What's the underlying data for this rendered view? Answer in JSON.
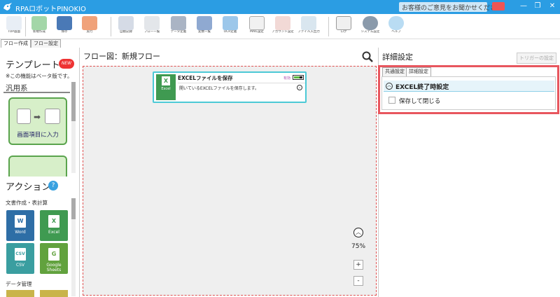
{
  "app": {
    "title": "RPAロボットPINOKIO",
    "feedback_label": "お客様のご意見をお聞かせください"
  },
  "toolbar": {
    "buttons": [
      {
        "label": "TOP画面",
        "icon": "top-screen-icon"
      },
      {
        "label": "新規作成",
        "icon": "new-file-icon"
      },
      {
        "label": "保存",
        "icon": "save-icon"
      },
      {
        "label": "実行",
        "icon": "run-icon"
      },
      {
        "label": "自動記録",
        "icon": "auto-record-icon"
      },
      {
        "label": "フロー一覧",
        "icon": "flow-list-icon"
      },
      {
        "label": "データ定義",
        "icon": "database-icon"
      },
      {
        "label": "変数一覧",
        "icon": "variables-icon"
      },
      {
        "label": "OCR定義",
        "icon": "ocr-icon"
      },
      {
        "label": "MAIL設定",
        "icon": "mail-icon"
      },
      {
        "label": "アカウント設定",
        "icon": "account-icon"
      },
      {
        "label": "ファイル入出力",
        "icon": "file-io-icon"
      },
      {
        "label": "ログ",
        "icon": "log-icon"
      },
      {
        "label": "システム設定",
        "icon": "gear-icon"
      },
      {
        "label": "ヘルプ",
        "icon": "help-icon"
      }
    ]
  },
  "tabs": [
    "フロー作成",
    "フロー設定"
  ],
  "templates": {
    "title": "テンプレート",
    "new_badge": "NEW",
    "beta_note": "※この機能はベータ版です。",
    "category": "汎用系",
    "card1": {
      "label": "画面項目に入力",
      "left_caption": "マウス操作",
      "right_caption": "キー操作"
    }
  },
  "actions": {
    "title": "アクション",
    "help": "?",
    "doc_category": "文書作成・表計算",
    "items": [
      {
        "label": "Word",
        "glyph": "W",
        "color": "#2e6ea6"
      },
      {
        "label": "Excel",
        "glyph": "X",
        "color": "#3f9a51"
      },
      {
        "label": "CSV",
        "glyph": "CSV",
        "color": "#3a9ea0"
      },
      {
        "label": "Google Sheets",
        "glyph": "G",
        "color": "#62a23e"
      }
    ],
    "data_category": "データ管理"
  },
  "flow": {
    "title": "フロー図：新規フロー",
    "node": {
      "icon_label": "Excel",
      "title": "EXCELファイルを保存",
      "badge": "有効",
      "desc": "開いているEXCELファイルを保存します。"
    },
    "zoom_level": "75%",
    "zoom_in": "+",
    "zoom_out": "-"
  },
  "details": {
    "title": "詳細設定",
    "trigger_button": "トリガーの設定",
    "tabs": [
      "共通設定",
      "詳細設定"
    ],
    "section_title": "EXCEL終了時設定",
    "checkbox_label": "保存して閉じる",
    "checkbox_checked": false
  },
  "colors": {
    "titlebar": "#2b9de3",
    "highlight": "#e8565e",
    "node_border": "#4cc9d6"
  }
}
